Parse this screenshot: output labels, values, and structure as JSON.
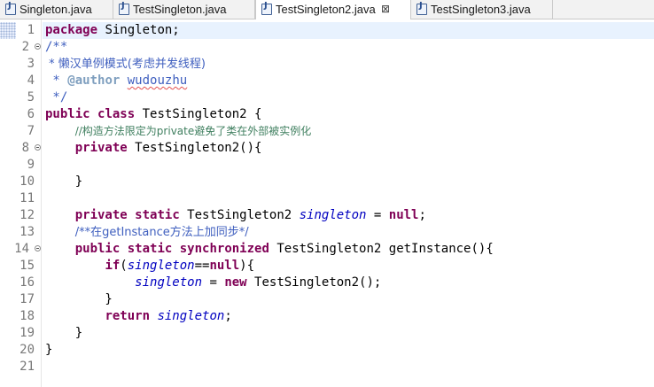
{
  "tabs": [
    {
      "label": "Singleton.java"
    },
    {
      "label": "TestSingleton.java"
    },
    {
      "label": "TestSingleton2.java",
      "close": "⊠"
    },
    {
      "label": "TestSingleton3.java"
    }
  ],
  "colors": {
    "keyword": "#7f0055",
    "javadoc": "#3f5fbf",
    "line_comment": "#3f7f5f",
    "field": "#0000c0",
    "current_line": "#e8f2fe"
  },
  "editor": {
    "line_numbers": [
      "1",
      "2",
      "3",
      "4",
      "5",
      "6",
      "7",
      "8",
      "9",
      "10",
      "11",
      "12",
      "13",
      "14",
      "15",
      "16",
      "17",
      "18",
      "19",
      "20",
      "21"
    ],
    "l1": {
      "kw_package": "package",
      "name": " Singleton;"
    },
    "l2": {
      "doc": "/**"
    },
    "l3": {
      "doc": " * 懒汉单例模式(考虑并发线程)"
    },
    "l4": {
      "doc_star": " * ",
      "tag": "@author",
      "space": " ",
      "author": "wudouzhu"
    },
    "l5": {
      "doc": " */"
    },
    "l6": {
      "kw_public": "public",
      "sp1": " ",
      "kw_class": "class",
      "rest": " TestSingleton2 {"
    },
    "l7": {
      "indent": "    ",
      "comment": "//构造方法限定为private避免了类在外部被实例化"
    },
    "l8": {
      "indent": "    ",
      "kw_private": "private",
      "rest": " TestSingleton2(){"
    },
    "l10": {
      "text": "    }"
    },
    "l12": {
      "indent": "    ",
      "kw_private": "private",
      "sp1": " ",
      "kw_static": "static",
      "mid": " TestSingleton2 ",
      "field": "singleton",
      "eq": " = ",
      "kw_null": "null",
      "end": ";"
    },
    "l13": {
      "indent": "    ",
      "doc": "/**在getInstance方法上加同步*/"
    },
    "l14": {
      "indent": "    ",
      "kw_public": "public",
      "sp1": " ",
      "kw_static": "static",
      "sp2": " ",
      "kw_sync": "synchronized",
      "rest": " TestSingleton2 getInstance(){"
    },
    "l15": {
      "indent": "        ",
      "kw_if": "if",
      "paren": "(",
      "field": "singleton",
      "eq": "==",
      "kw_null": "null",
      "end": "){"
    },
    "l16": {
      "indent": "            ",
      "field": "singleton",
      "eq": " = ",
      "kw_new": "new",
      "rest": " TestSingleton2();"
    },
    "l17": {
      "text": "        }"
    },
    "l18": {
      "indent": "        ",
      "kw_return": "return",
      "sp": " ",
      "field": "singleton",
      "end": ";"
    },
    "l19": {
      "text": "    }"
    },
    "l20": {
      "text": "}"
    }
  }
}
